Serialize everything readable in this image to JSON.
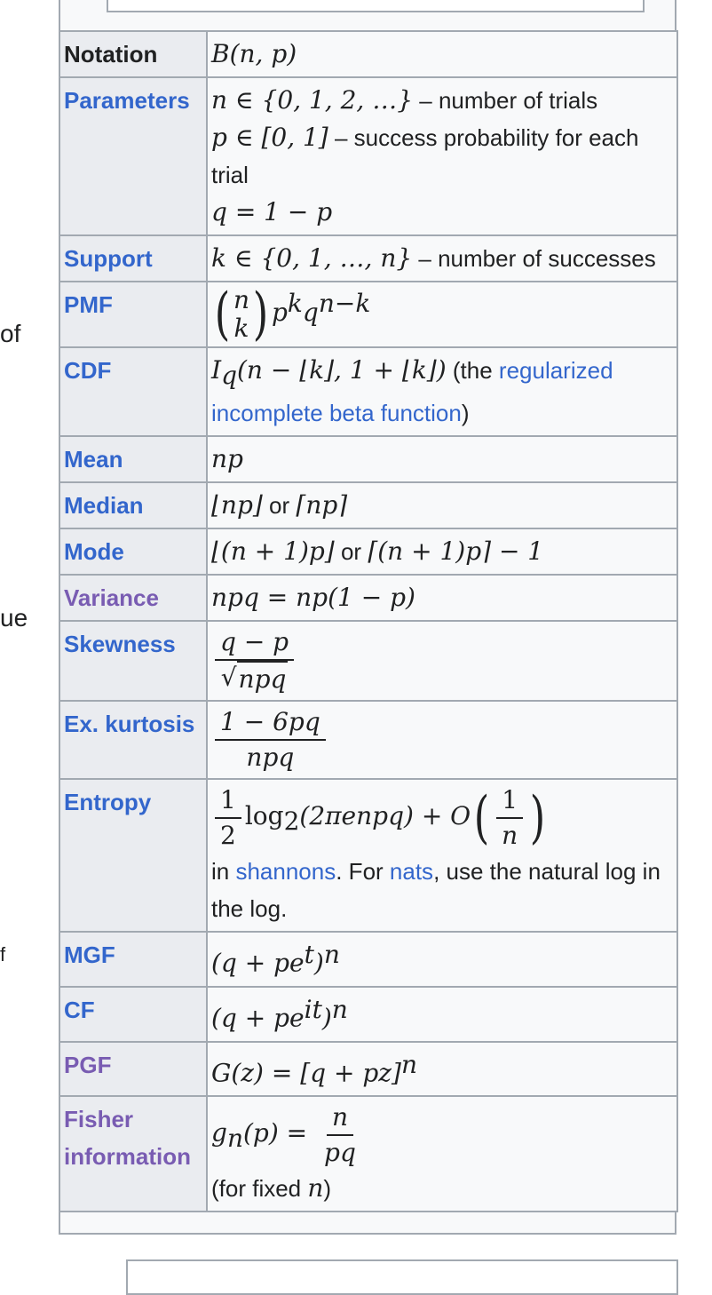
{
  "left_fragments": [
    "of",
    "ue",
    "f"
  ],
  "infobox": {
    "rows": {
      "notation": {
        "label": "Notation",
        "math": "B(n, p)"
      },
      "parameters": {
        "label": "Parameters",
        "n_math": "n ∈ {0, 1, 2, …}",
        "n_text": " – number of trials",
        "p_math": "p ∈ [0, 1]",
        "p_text": " – success probability for each trial",
        "q_math": "q = 1 − p"
      },
      "support": {
        "label": "Support",
        "math": "k ∈ {0, 1, …, n}",
        "text": " – number of successes"
      },
      "pmf": {
        "label": "PMF",
        "binom_top": "n",
        "binom_bottom": "k",
        "tail": "p",
        "sup_k": "k",
        "q": "q",
        "sup_nk": "n−k"
      },
      "cdf": {
        "label": "CDF",
        "math": "I",
        "sub": "q",
        "math_rest": "(n − ⌊k⌋, 1 + ⌊k⌋)",
        "text_pre": " (the ",
        "link": "regularized incomplete beta function",
        "text_post": ")"
      },
      "mean": {
        "label": "Mean",
        "math": "np"
      },
      "median": {
        "label": "Median",
        "math1": "⌊np⌋",
        "or": " or ",
        "math2": "⌈np⌉"
      },
      "mode": {
        "label": "Mode",
        "math1": "⌊(n + 1)p⌋",
        "or": " or ",
        "math2": "⌈(n + 1)p⌉ − 1"
      },
      "variance": {
        "label": "Variance",
        "math": "npq = np(1 − p)"
      },
      "skewness": {
        "label": "Skewness",
        "num": "q − p",
        "den": "npq"
      },
      "kurtosis": {
        "label": "Ex. kurtosis",
        "num": "1 − 6pq",
        "den": "npq"
      },
      "entropy": {
        "label": "Entropy",
        "half_num": "1",
        "half_den": "2",
        "log": "log",
        "log_sub": "2",
        "arg": "(2πenpq) + O",
        "inner_num": "1",
        "inner_den": "n",
        "text_pre": "in ",
        "link1": "shannons",
        "text_mid": ". For ",
        "link2": "nats",
        "text_post": ", use the natural log in the log."
      },
      "mgf": {
        "label": "MGF",
        "math_pre": "(q + pe",
        "sup": "t",
        "math_post": ")",
        "exp": "n"
      },
      "cf": {
        "label": "CF",
        "math_pre": "(q + pe",
        "sup": "it",
        "math_post": ")",
        "exp": "n"
      },
      "pgf": {
        "label": "PGF",
        "math": "G(z) = [q + pz]",
        "exp": "n"
      },
      "fisher": {
        "label": "Fisher information",
        "lhs": "g",
        "lhs_sub": "n",
        "lhs_rest": "(p) = ",
        "num": "n",
        "den": "pq",
        "note_pre": "(for fixed ",
        "note_var": "n",
        "note_post": ")"
      }
    }
  },
  "colors": {
    "link": "#3366cc",
    "visited": "#795cb2",
    "border": "#a2a9b1",
    "header_bg": "#eaecf0",
    "cell_bg": "#f8f9fa"
  }
}
